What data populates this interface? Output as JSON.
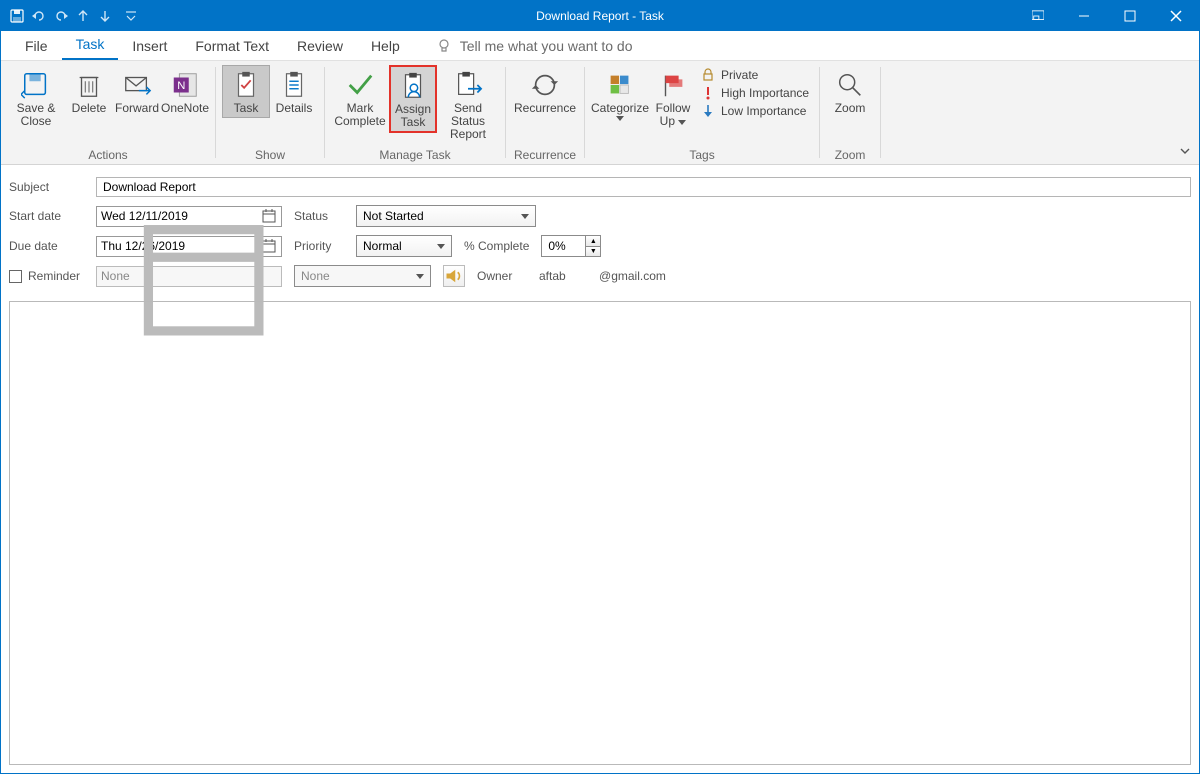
{
  "title": "Download Report  -  Task",
  "qat": {
    "items": [
      "save-icon",
      "undo-icon",
      "redo-icon",
      "prev-icon",
      "next-icon"
    ]
  },
  "menus": {
    "file": "File",
    "task": "Task",
    "insert": "Insert",
    "format": "Format Text",
    "review": "Review",
    "help": "Help",
    "tellme": "Tell me what you want to do"
  },
  "ribbon": {
    "actions": {
      "save_close_1": "Save &",
      "save_close_2": "Close",
      "delete": "Delete",
      "forward": "Forward",
      "onenote": "OneNote",
      "label": "Actions"
    },
    "show": {
      "task": "Task",
      "details": "Details",
      "label": "Show"
    },
    "manage": {
      "mark_1": "Mark",
      "mark_2": "Complete",
      "assign_1": "Assign",
      "assign_2": "Task",
      "send_1": "Send Status",
      "send_2": "Report",
      "label": "Manage Task"
    },
    "recur": {
      "recurrence": "Recurrence",
      "label": "Recurrence"
    },
    "tags": {
      "categorize": "Categorize",
      "followup_1": "Follow",
      "followup_2": "Up",
      "private": "Private",
      "high": "High Importance",
      "low": "Low Importance",
      "label": "Tags"
    },
    "zoom": {
      "zoom": "Zoom",
      "label": "Zoom"
    }
  },
  "form": {
    "subject_label": "Subject",
    "subject": "Download Report",
    "start_label": "Start date",
    "start_date": "Wed 12/11/2019",
    "due_label": "Due date",
    "due_date": "Thu 12/26/2019",
    "reminder_label": "Reminder",
    "reminder_date": "None",
    "reminder_time": "None",
    "status_label": "Status",
    "status": "Not Started",
    "priority_label": "Priority",
    "priority": "Normal",
    "pct_label": "% Complete",
    "pct": "0%",
    "owner_label": "Owner",
    "owner": "aftab          @gmail.com"
  }
}
